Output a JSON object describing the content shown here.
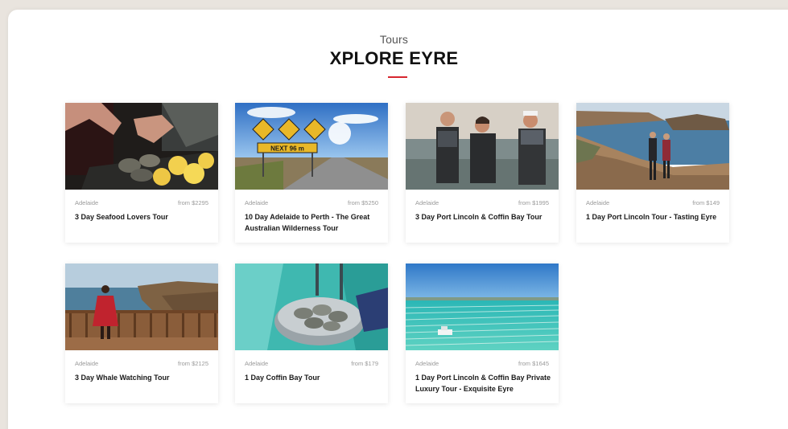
{
  "header": {
    "eyebrow": "Tours",
    "title": "XPLORE EYRE",
    "accent_color": "#d7262f"
  },
  "tours": [
    {
      "location": "Adelaide",
      "price": "from $2295",
      "name": "3 Day Seafood Lovers Tour",
      "image": "oysters-grill-photo"
    },
    {
      "location": "Adelaide",
      "price": "from $5250",
      "name": "10 Day Adelaide to Perth - The Great Australian Wilderness Tour",
      "image": "road-signs-photo",
      "sign_text": "NEXT 96 m"
    },
    {
      "location": "Adelaide",
      "price": "from $1995",
      "name": "3 Day Port Lincoln & Coffin Bay Tour",
      "image": "oyster-farmers-photo"
    },
    {
      "location": "Adelaide",
      "price": "from $149",
      "name": "1 Day Port Lincoln Tour - Tasting Eyre",
      "image": "coastal-cliff-couple-photo"
    },
    {
      "location": "Adelaide",
      "price": "from $2125",
      "name": "3 Day Whale Watching Tour",
      "image": "whale-lookout-photo"
    },
    {
      "location": "Adelaide",
      "price": "from $179",
      "name": "1 Day Coffin Bay Tour",
      "image": "oyster-bowl-photo"
    },
    {
      "location": "Adelaide",
      "price": "from $1645",
      "name": "1 Day Port Lincoln & Coffin Bay Private Luxury Tour - Exquisite Eyre",
      "image": "aerial-oyster-farm-photo"
    }
  ]
}
